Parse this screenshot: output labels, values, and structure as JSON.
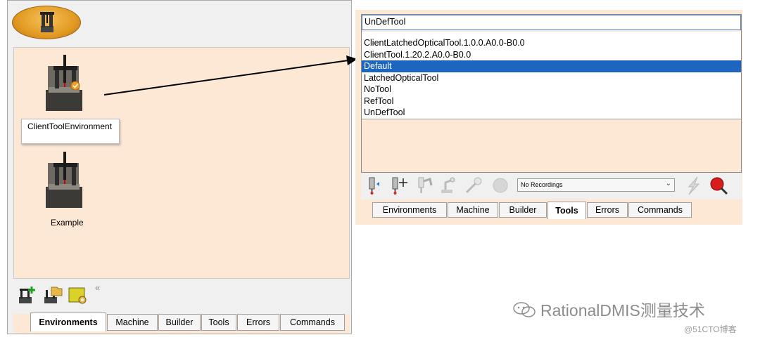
{
  "left_panel": {
    "items": [
      {
        "label": "ClientToolEnvironment"
      },
      {
        "label": "Example"
      }
    ],
    "collapse_label": "«",
    "tabs": [
      {
        "label": "Environments",
        "active": true
      },
      {
        "label": "Machine"
      },
      {
        "label": "Builder"
      },
      {
        "label": "Tools"
      },
      {
        "label": "Errors"
      },
      {
        "label": "Commands"
      }
    ]
  },
  "right_panel": {
    "tool_select_value": "UnDefTool",
    "tool_options": [
      {
        "label": "ClientLatchedOpticalTool.1.0.0.A0.0-B0.0"
      },
      {
        "label": "ClientTool.1.20.2.A0.0-B0.0"
      },
      {
        "label": "Default",
        "selected": true
      },
      {
        "label": "LatchedOpticalTool"
      },
      {
        "label": "NoTool"
      },
      {
        "label": "RefTool"
      },
      {
        "label": "UnDefTool"
      }
    ],
    "recording_select": "No Recordings",
    "tabs": [
      {
        "label": "Environments"
      },
      {
        "label": "Machine"
      },
      {
        "label": "Builder"
      },
      {
        "label": "Tools",
        "active": true
      },
      {
        "label": "Errors"
      },
      {
        "label": "Commands"
      }
    ]
  },
  "watermarks": {
    "wechat": "RationalDMIS测量技术",
    "site": "@51CTO博客"
  },
  "colors": {
    "canvas_peach": "#fde8d6",
    "selection_blue": "#1c65c0",
    "badge_orange": "#e29a22"
  }
}
